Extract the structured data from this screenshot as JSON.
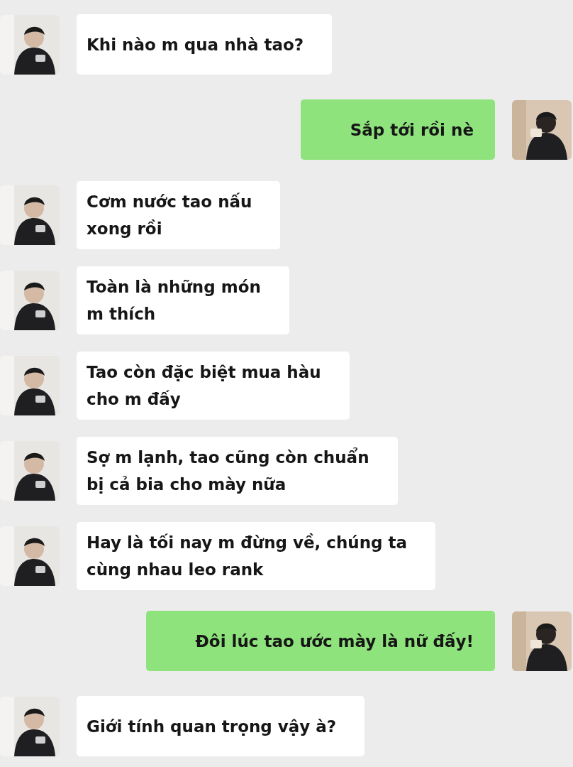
{
  "messages": [
    {
      "kind": "received",
      "text": "Khi nào m qua nhà tao?"
    },
    {
      "kind": "sent",
      "text": "Sắp tới rồi nè"
    },
    {
      "kind": "received",
      "text": "Cơm nước tao nấu\nxong rồi"
    },
    {
      "kind": "received",
      "text": "Toàn là những món\nm thích"
    },
    {
      "kind": "received",
      "text": "Tao còn đặc biệt mua hàu\ncho m đấy"
    },
    {
      "kind": "received",
      "text": "Sợ m lạnh, tao cũng còn chuẩn\nbị cả bia cho mày nữa"
    },
    {
      "kind": "received",
      "text": "Hay là tối nay m đừng về, chúng ta\ncùng nhau leo rank"
    },
    {
      "kind": "sent",
      "text": "Đôi lúc tao ước mày là nữ đấy!"
    },
    {
      "kind": "received",
      "text": "Giới tính quan trọng vậy à?"
    }
  ]
}
